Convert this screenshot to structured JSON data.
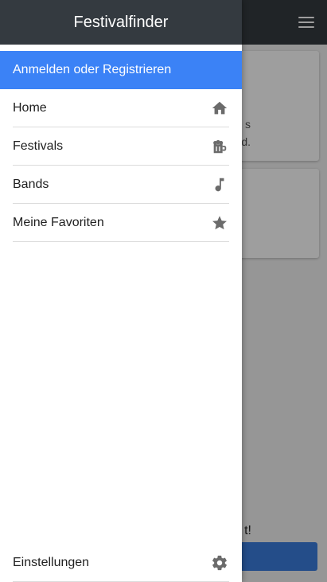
{
  "drawer": {
    "title": "Festivalfinder",
    "login_label": "Anmelden oder Registrieren",
    "items": [
      {
        "label": "Home",
        "icon": "home-icon"
      },
      {
        "label": "Festivals",
        "icon": "beer-mug-icon"
      },
      {
        "label": "Bands",
        "icon": "music-note-icon"
      },
      {
        "label": "Meine Favoriten",
        "icon": "star-icon"
      }
    ],
    "settings": {
      "label": "Einstellungen",
      "icon": "gear-icon"
    }
  },
  "background": {
    "card_line_1": "s",
    "card_line_2": "d.",
    "bottom_text": "t!"
  },
  "colors": {
    "header": "#343a40",
    "login_bar": "#3b82f6",
    "icon": "#6b6b6b",
    "background_button": "#3b7ddd"
  }
}
